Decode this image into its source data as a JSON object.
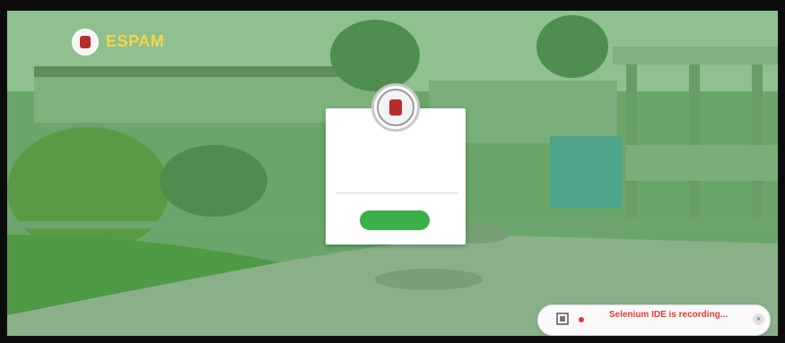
{
  "brand": {
    "name_prefix": "ESPAM",
    "name_suffix": "",
    "subtitle": "",
    "logo_icon": "university-seal-icon"
  },
  "login": {
    "title": "",
    "username_placeholder": "",
    "submit_label": ""
  },
  "notice": {
    "text": "Selenium IDE is recording...",
    "icon": "selenium-icon",
    "close_icon": "close-icon"
  },
  "colors": {
    "overlay_green": "#5d9c5d",
    "button_green": "#3bb04a",
    "brand_yellow": "#f6d546",
    "notice_red": "#e53935"
  }
}
